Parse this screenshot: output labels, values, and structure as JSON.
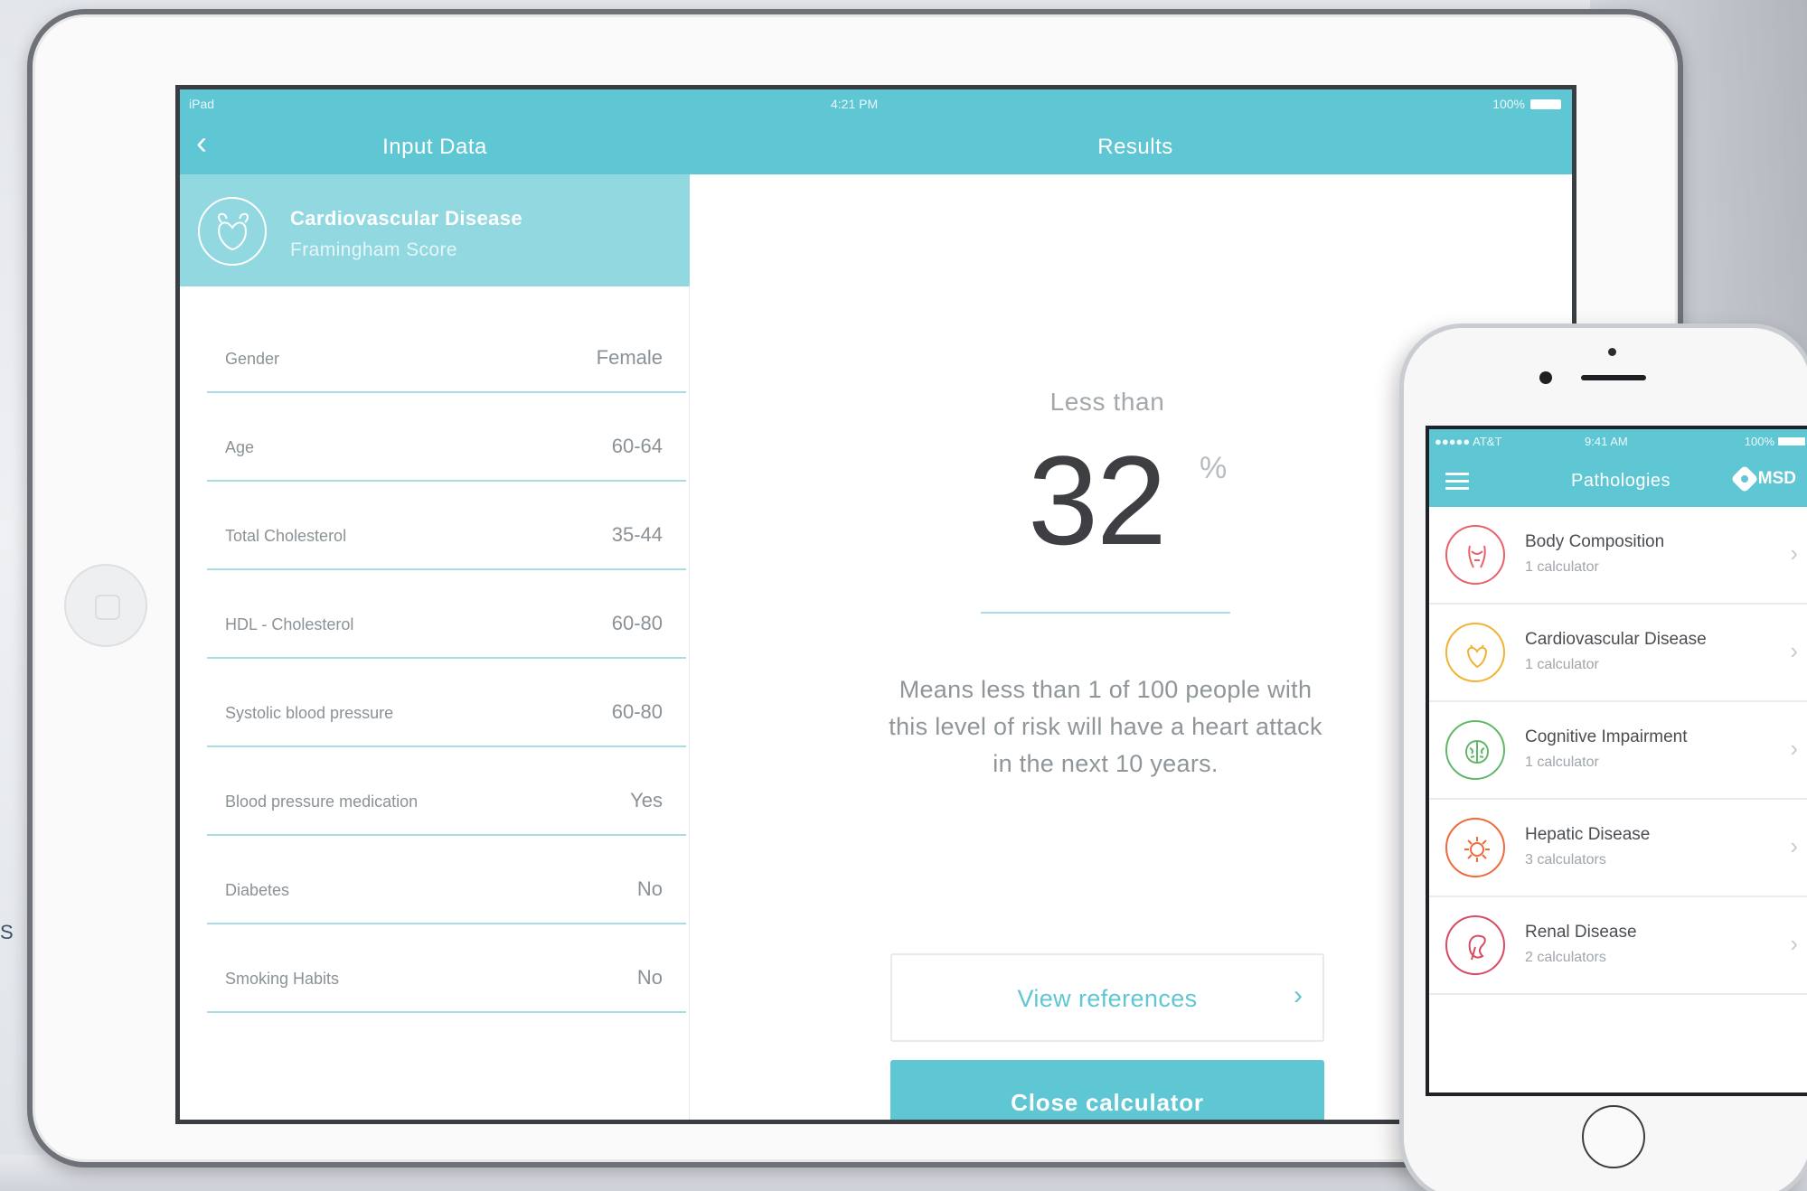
{
  "tablet": {
    "status": {
      "carrier": "iPad",
      "time": "4:21 PM",
      "battery": "100%"
    },
    "input_panel": {
      "title": "Input Data",
      "disease": {
        "name": "Cardiovascular Disease",
        "score": "Framingham Score"
      },
      "fields": [
        {
          "label": "Gender",
          "value": "Female"
        },
        {
          "label": "Age",
          "value": "60-64"
        },
        {
          "label": "Total Cholesterol",
          "value": "35-44"
        },
        {
          "label": "HDL - Cholesterol",
          "value": "60-80"
        },
        {
          "label": "Systolic blood pressure",
          "value": "60-80"
        },
        {
          "label": "Blood pressure medication",
          "value": "Yes"
        },
        {
          "label": "Diabetes",
          "value": "No"
        },
        {
          "label": "Smoking Habits",
          "value": "No"
        }
      ]
    },
    "results_panel": {
      "title": "Results",
      "qualifier": "Less than",
      "value": "32",
      "unit": "%",
      "description": "Means less than 1 of 100 people with this level of risk will have a heart attack in the next 10 years.",
      "view_references_label": "View references",
      "close_label": "Close calculator"
    }
  },
  "phone": {
    "status": {
      "carrier": "●●●●● AT&T",
      "time": "9:41 AM",
      "battery": "100%"
    },
    "title": "Pathologies",
    "brand": "MSD",
    "items": [
      {
        "name": "Body Composition",
        "count": "1 calculator",
        "color": "#e8626b",
        "icon": "body-icon"
      },
      {
        "name": "Cardiovascular Disease",
        "count": "1 calculator",
        "color": "#f2b233",
        "icon": "heart-icon"
      },
      {
        "name": "Cognitive Impairment",
        "count": "1 calculator",
        "color": "#62b86a",
        "icon": "brain-icon"
      },
      {
        "name": "Hepatic Disease",
        "count": "3 calculators",
        "color": "#ef6a3c",
        "icon": "liver-icon"
      },
      {
        "name": "Renal Disease",
        "count": "2 calculators",
        "color": "#d94a63",
        "icon": "kidney-icon"
      }
    ]
  },
  "colors": {
    "accent": "#5fc6d4",
    "accent_light": "#91d8e1",
    "text_muted": "#8a9297"
  }
}
